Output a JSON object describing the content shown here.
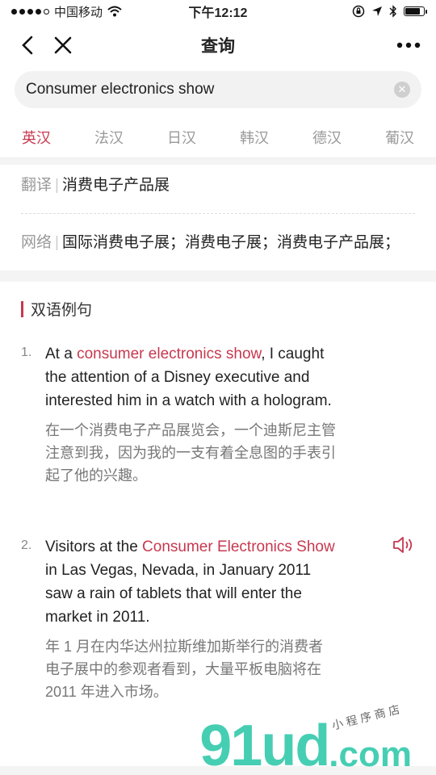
{
  "status": {
    "carrier": "中国移动",
    "time": "下午12:12"
  },
  "nav": {
    "title": "查询"
  },
  "search": {
    "value": "Consumer electronics show"
  },
  "tabs": [
    "英汉",
    "法汉",
    "日汉",
    "韩汉",
    "德汉",
    "葡汉"
  ],
  "translation": {
    "label": "翻译",
    "text": "消费电子产品展"
  },
  "network": {
    "label": "网络",
    "text": "国际消费电子展；消费电子展；消费电子产品展；"
  },
  "section": {
    "title": "双语例句"
  },
  "examples": [
    {
      "num": "1.",
      "en_before": "At a ",
      "en_highlight": "consumer electronics show",
      "en_after": ", I caught the attention of a Disney executive and interested him in a watch with a hologram.",
      "zh": "在一个消费电子产品展览会，一个迪斯尼主管注意到我，因为我的一支有着全息图的手表引起了他的兴趣。"
    },
    {
      "num": "2.",
      "en_before": "Visitors at the ",
      "en_highlight": "Consumer Electronics Show",
      "en_after": " in Las Vegas, Nevada, in January 2011 saw a rain of tablets that will enter the market in 2011.",
      "zh": "年 1 月在内华达州拉斯维加斯举行的消费者电子展中的参观者看到，大量平板电脑将在 2011 年进入市场。"
    }
  ],
  "watermark": {
    "brand": "91ud",
    "domain": ".com",
    "cn": "小程序商店"
  },
  "colors": {
    "accent": "#c7384f",
    "watermark": "#26c6a6"
  }
}
